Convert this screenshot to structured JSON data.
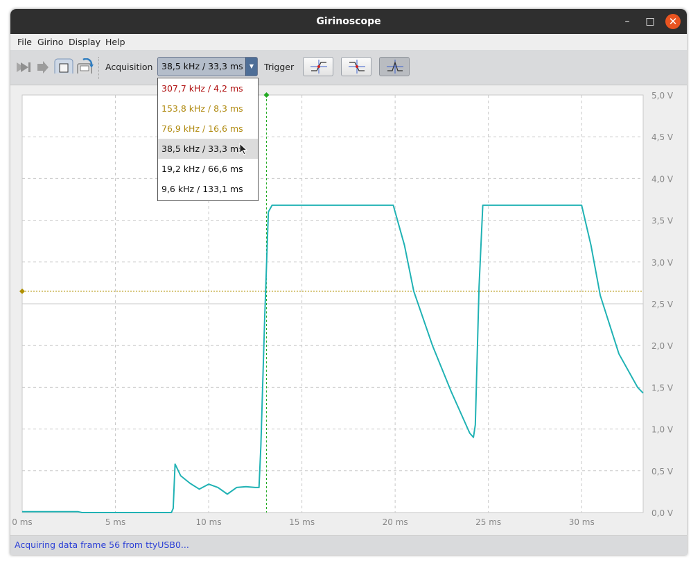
{
  "window": {
    "title": "Girinoscope"
  },
  "menubar": {
    "items": [
      "File",
      "Girino",
      "Display",
      "Help"
    ]
  },
  "toolbar": {
    "acquisition_label": "Acquisition",
    "acquisition_value": "38,5 kHz / 33,3 ms",
    "trigger_label": "Trigger",
    "acquisition_options": [
      {
        "label": "307,7 kHz / 4,2 ms",
        "color": "#b01010"
      },
      {
        "label": "153,8 kHz / 8,3 ms",
        "color": "#b08a10"
      },
      {
        "label": "76,9 kHz / 16,6 ms",
        "color": "#b08a10"
      },
      {
        "label": "38,5 kHz / 33,3 ms",
        "color": "#111111"
      },
      {
        "label": "19,2 kHz / 66,6 ms",
        "color": "#111111"
      },
      {
        "label": "9,6 kHz / 133,1 ms",
        "color": "#111111"
      }
    ],
    "selected_option": "38,5 kHz / 33,3 ms",
    "icons": [
      "step-forward-icon",
      "play-icon",
      "stop-icon",
      "save-frame-icon",
      "trigger-rising-edge-icon",
      "trigger-falling-edge-icon",
      "trigger-both-edges-icon"
    ]
  },
  "status": {
    "text": "Acquiring data frame 56 from ttyUSB0..."
  },
  "chart_data": {
    "type": "line",
    "title": "",
    "xlabel": "",
    "ylabel": "",
    "xlim": [
      0,
      33.3
    ],
    "ylim": [
      0,
      5
    ],
    "x_ticks": [
      "0 ms",
      "5 ms",
      "10 ms",
      "15 ms",
      "20 ms",
      "25 ms",
      "30 ms"
    ],
    "x_tick_values": [
      0,
      5,
      10,
      15,
      20,
      25,
      30
    ],
    "y_ticks": [
      "0,0 V",
      "0,5 V",
      "1,0 V",
      "1,5 V",
      "2,0 V",
      "2,5 V",
      "3,0 V",
      "3,5 V",
      "4,0 V",
      "4,5 V",
      "5,0 V"
    ],
    "y_tick_values": [
      0,
      0.5,
      1,
      1.5,
      2,
      2.5,
      3,
      3.5,
      4,
      4.5,
      5
    ],
    "grid": true,
    "trigger_level_v": 2.65,
    "trigger_time_ms": 13.1,
    "colors": {
      "signal": "#20b2b4",
      "trigger_level": "#b09000",
      "trigger_time": "#22aa22"
    },
    "series": [
      {
        "x": [
          0,
          3,
          3.2,
          8,
          8.1,
          8.2,
          8.5,
          9,
          9.5,
          10,
          10.5,
          11,
          11.5,
          12,
          12.5,
          12.7,
          12.8,
          13.0,
          13.2,
          13.4,
          19.9,
          20.5,
          21,
          22,
          23,
          24,
          24.2,
          24.3,
          24.5,
          24.7,
          25,
          30,
          30.5,
          31,
          32,
          33,
          33.3
        ],
        "y": [
          0.01,
          0.01,
          0.0,
          0.0,
          0.05,
          0.58,
          0.44,
          0.35,
          0.28,
          0.34,
          0.3,
          0.22,
          0.3,
          0.31,
          0.3,
          0.3,
          0.8,
          2.3,
          3.6,
          3.68,
          3.68,
          3.2,
          2.65,
          2.0,
          1.45,
          0.95,
          0.9,
          1.05,
          2.7,
          3.68,
          3.68,
          3.68,
          3.2,
          2.6,
          1.9,
          1.5,
          1.43
        ]
      }
    ]
  }
}
